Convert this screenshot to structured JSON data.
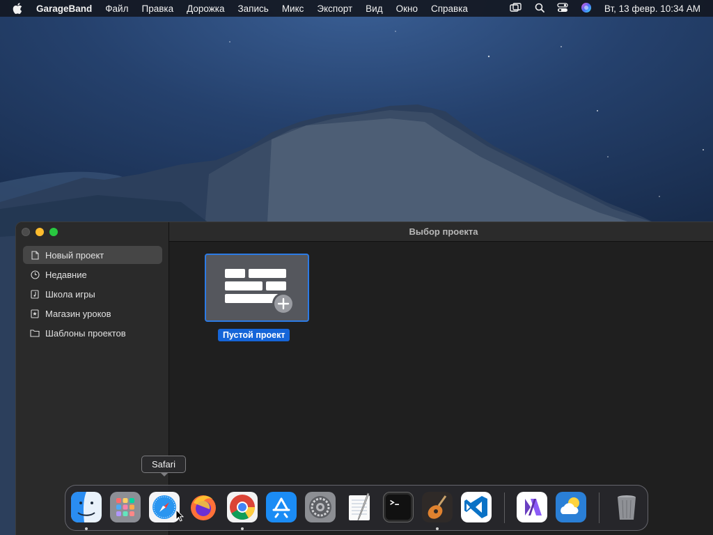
{
  "menubar": {
    "app_name": "GarageBand",
    "items": [
      "Файл",
      "Правка",
      "Дорожка",
      "Запись",
      "Микс",
      "Экспорт",
      "Вид",
      "Окно",
      "Справка"
    ],
    "clock": "Вт, 13 февр.  10:34 AM",
    "icons": [
      "apple-icon",
      "screen-mirroring-icon",
      "search-icon",
      "control-center-icon",
      "siri-icon"
    ]
  },
  "window": {
    "title": "Выбор проекта",
    "sidebar": {
      "items": [
        {
          "label": "Новый проект",
          "icon": "document-icon",
          "active": true
        },
        {
          "label": "Недавние",
          "icon": "clock-icon",
          "active": false
        },
        {
          "label": "Школа игры",
          "icon": "music-note-icon",
          "active": false
        },
        {
          "label": "Магазин уроков",
          "icon": "star-icon",
          "active": false
        },
        {
          "label": "Шаблоны проектов",
          "icon": "folder-icon",
          "active": false
        }
      ]
    },
    "project_tile": {
      "label": "Пустой проект",
      "icon": "empty-project-plus-icon"
    }
  },
  "dock": {
    "tooltip": "Safari",
    "apps": [
      "Finder",
      "Launchpad",
      "Safari",
      "Firefox",
      "Chrome",
      "App Store",
      "System Preferences",
      "TextEdit",
      "Terminal",
      "GarageBand",
      "Visual Studio Code",
      "Visual Studio",
      "Weather",
      "Trash"
    ]
  },
  "colors": {
    "accent": "#1565d8",
    "selection_border": "#2c7be5",
    "close": "#4b4b4b",
    "minimize": "#febc2e",
    "maximize": "#28c840"
  }
}
